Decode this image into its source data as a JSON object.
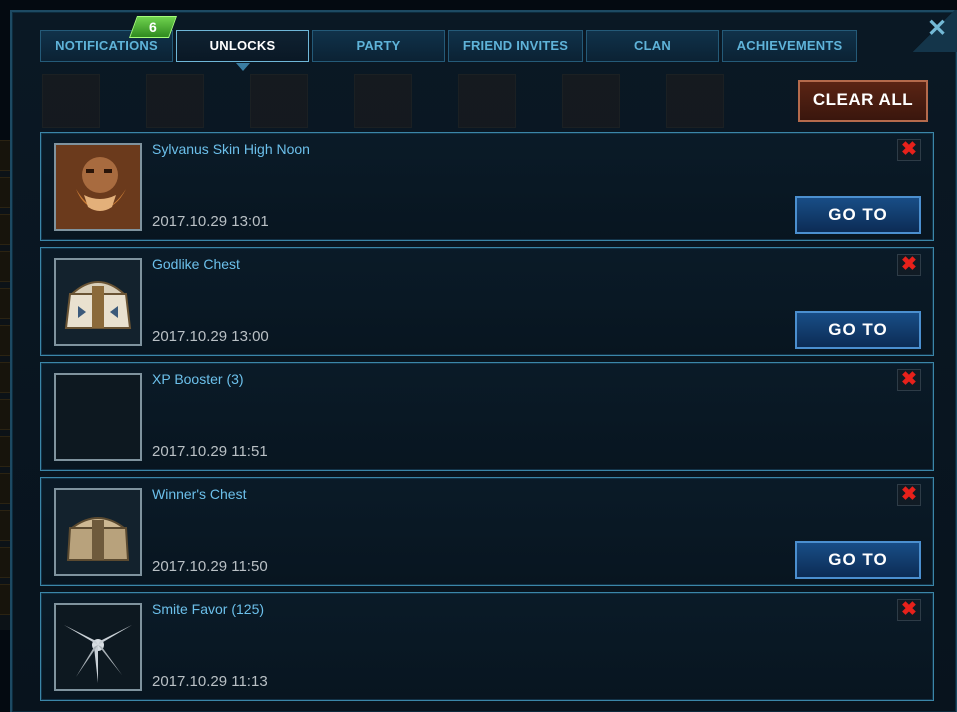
{
  "window": {
    "close_glyph": "✕"
  },
  "tabs": [
    {
      "label": "NOTIFICATIONS",
      "active": false
    },
    {
      "label": "UNLOCKS",
      "active": true
    },
    {
      "label": "PARTY",
      "active": false
    },
    {
      "label": "FRIEND INVITES",
      "active": false
    },
    {
      "label": "CLAN",
      "active": false
    },
    {
      "label": "ACHIEVEMENTS",
      "active": false
    }
  ],
  "notifications_badge": "6",
  "clear_all_label": "CLEAR ALL",
  "items": [
    {
      "title": "Sylvanus Skin High Noon",
      "time": "2017.10.29 13:01",
      "icon": "sylvanus-portrait-icon",
      "has_goto": true
    },
    {
      "title": "Godlike Chest",
      "time": "2017.10.29 13:00",
      "icon": "godlike-chest-icon",
      "has_goto": true
    },
    {
      "title": "XP Booster (3)",
      "time": "2017.10.29 11:51",
      "icon": "xp-booster-icon",
      "has_goto": false
    },
    {
      "title": "Winner's Chest",
      "time": "2017.10.29 11:50",
      "icon": "winners-chest-icon",
      "has_goto": true
    },
    {
      "title": "Smite Favor (125)",
      "time": "2017.10.29 11:13",
      "icon": "smite-favor-icon",
      "has_goto": false
    }
  ],
  "goto_label": "GO TO",
  "dismiss_glyph": "✖",
  "colors": {
    "accent": "#6cc0eb",
    "panel_border": "#3b86a8",
    "dismiss_red": "#e8211b",
    "badge_green": "#4db434",
    "goto_blue": "#184d86"
  }
}
